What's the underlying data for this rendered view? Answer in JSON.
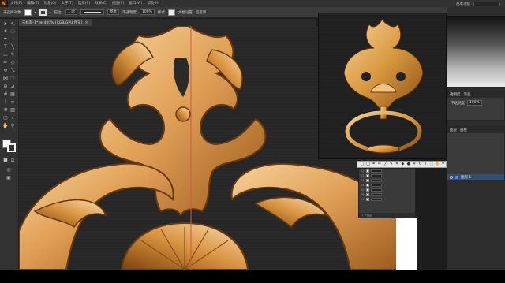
{
  "app": {
    "logo": "Ai",
    "menu": [
      "文件(F)",
      "编辑(E)",
      "对象(O)",
      "文字(T)",
      "选择(S)",
      "效果(C)",
      "视图(V)",
      "窗口(W)",
      "帮助(H)"
    ],
    "workspace": "基本功能"
  },
  "control_bar": {
    "selection_label": "未选择对象",
    "stroke_size": "1 pt",
    "brush_label": "基本",
    "opacity_label": "不透明度",
    "opacity_value": "100%",
    "style_label": "样式",
    "doc_setup": "文档设置",
    "preferences": "首选项"
  },
  "document": {
    "tab_title": "未标题-1* @ 400% (RGB/GPU 预览)"
  },
  "panels": {
    "tabs_top": [
      "透明度",
      "渐变"
    ],
    "opacity_label": "不透明度",
    "opacity_value": "100%",
    "layers_tabs": [
      "图层",
      "画板"
    ],
    "layer_name": "图层 1",
    "layers_footer": "1 个图层"
  },
  "mini_layers": {
    "rows": [
      "01",
      "02",
      "03",
      "04",
      "05",
      "06",
      "07"
    ],
    "footer": "1 个图层"
  },
  "colors": {
    "gold_light": "#f4c47b",
    "gold_mid": "#d99a45",
    "gold_dark": "#8a4f12",
    "guide_line": "#d9534f",
    "accent": "#ff9a00"
  },
  "icons": {
    "toolbar": [
      "selection-icon",
      "direct-selection-icon",
      "magic-wand-icon",
      "lasso-icon",
      "pen-icon",
      "curvature-icon",
      "type-icon",
      "line-icon",
      "rectangle-icon",
      "paintbrush-icon",
      "pencil-icon",
      "eraser-icon",
      "rotate-icon",
      "scale-icon",
      "width-icon",
      "free-transform-icon",
      "shape-builder-icon",
      "perspective-icon",
      "mesh-icon",
      "gradient-icon",
      "eyedropper-icon",
      "blend-icon",
      "symbol-sprayer-icon",
      "graph-icon",
      "artboard-icon",
      "slice-icon",
      "hand-icon",
      "zoom-icon"
    ]
  }
}
